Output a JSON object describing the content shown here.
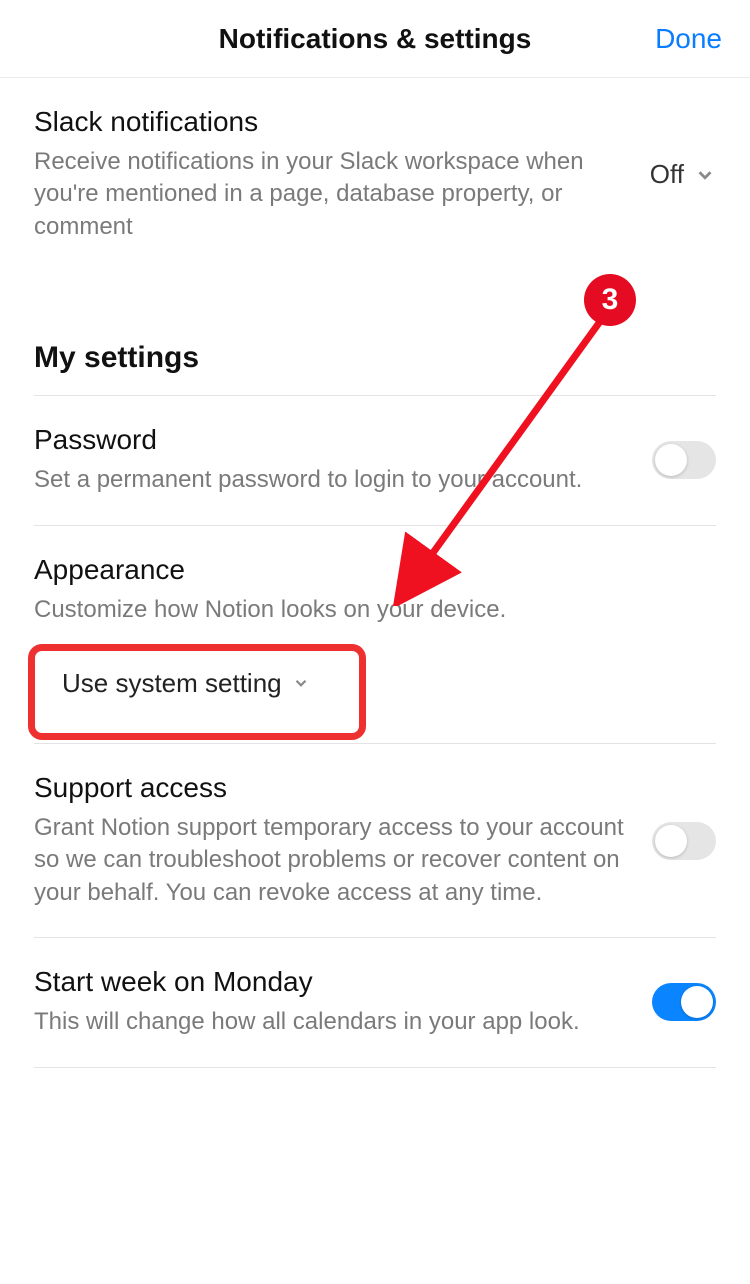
{
  "header": {
    "title": "Notifications & settings",
    "done_label": "Done"
  },
  "slack": {
    "title": "Slack notifications",
    "desc": "Receive notifications in your Slack workspace when you're mentioned in a page, database property, or comment",
    "value": "Off"
  },
  "my_settings_heading": "My settings",
  "password": {
    "title": "Password",
    "desc": "Set a permanent password to login to your account."
  },
  "appearance": {
    "title": "Appearance",
    "desc": "Customize how Notion looks on your device.",
    "selected": "Use system setting"
  },
  "support": {
    "title": "Support access",
    "desc": "Grant Notion support temporary access to your account so we can troubleshoot problems or recover content on your behalf. You can revoke access at any time."
  },
  "start_week": {
    "title": "Start week on Monday",
    "desc": "This will change how all calendars in your app look."
  },
  "annotation": {
    "badge": "3"
  }
}
